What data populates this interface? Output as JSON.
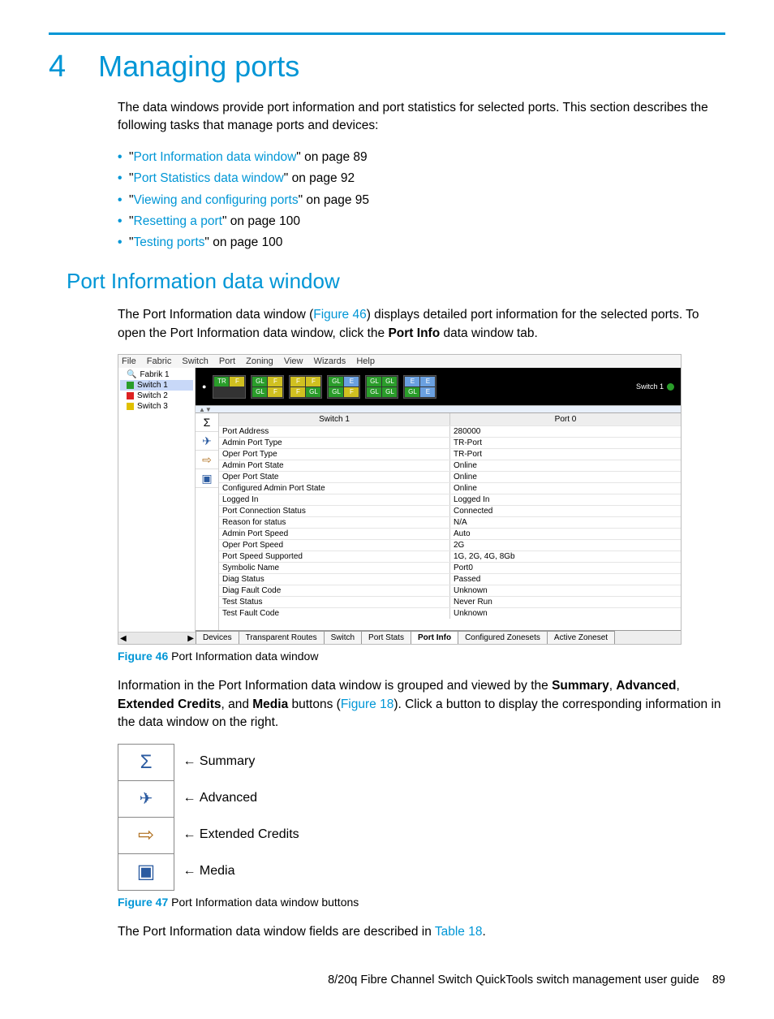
{
  "chapter": {
    "number": "4",
    "title": "Managing ports"
  },
  "intro": "The data windows provide port information and port statistics for selected ports. This section describes the following tasks that manage ports and devices:",
  "toc": [
    {
      "link": "Port Information data window",
      "suffix": " on page 89"
    },
    {
      "link": "Port Statistics data window",
      "suffix": " on page 92"
    },
    {
      "link": "Viewing and configuring ports",
      "suffix": " on page 95"
    },
    {
      "link": "Resetting a port",
      "suffix": " on page 100"
    },
    {
      "link": "Testing ports",
      "suffix": " on page 100"
    }
  ],
  "h2": "Port Information data window",
  "p2a": "The Port Information data window (",
  "p2link": "Figure 46",
  "p2b_1": ") displays detailed port information for the selected ports. To open the Port Information data window, click the ",
  "p2b_bold": "Port Info",
  "p2b_2": " data window tab.",
  "menus": [
    "File",
    "Fabric",
    "Switch",
    "Port",
    "Zoning",
    "View",
    "Wizards",
    "Help"
  ],
  "tree": {
    "root": "Fabrik 1",
    "items": [
      "Switch 1",
      "Switch 2",
      "Switch 3"
    ]
  },
  "faceplate": {
    "groups": [
      [
        [
          "TR",
          "g"
        ],
        [
          "F",
          "y"
        ]
      ],
      [
        [
          "GL",
          "g"
        ],
        [
          "F",
          "y"
        ],
        [
          "GL",
          "g"
        ],
        [
          "F",
          "y"
        ]
      ],
      [
        [
          "F",
          "y"
        ],
        [
          "F",
          "y"
        ],
        [
          "F",
          "y"
        ],
        [
          "GL",
          "g"
        ]
      ],
      [
        [
          "GL",
          "g"
        ],
        [
          "E",
          "b"
        ],
        [
          "GL",
          "g"
        ],
        [
          "F",
          "y"
        ]
      ],
      [
        [
          "GL",
          "g"
        ],
        [
          "GL",
          "g"
        ],
        [
          "GL",
          "g"
        ],
        [
          "GL",
          "g"
        ]
      ],
      [
        [
          "E",
          "b"
        ],
        [
          "E",
          "b"
        ],
        [
          "GL",
          "g"
        ],
        [
          "E",
          "b"
        ]
      ]
    ],
    "switch_label": "Switch 1"
  },
  "table": {
    "hdr_left": "Switch 1",
    "hdr_right": "Port 0",
    "rows": [
      [
        "Port Address",
        "280000"
      ],
      [
        "Admin Port Type",
        "TR-Port"
      ],
      [
        "Oper Port Type",
        "TR-Port"
      ],
      [
        "Admin Port State",
        "Online"
      ],
      [
        "Oper Port State",
        "Online"
      ],
      [
        "Configured Admin Port State",
        "Online"
      ],
      [
        "Logged In",
        "Logged In"
      ],
      [
        "Port Connection Status",
        "Connected"
      ],
      [
        "Reason for status",
        "N/A"
      ],
      [
        "Admin Port Speed",
        "Auto"
      ],
      [
        "Oper Port Speed",
        "2G"
      ],
      [
        "Port Speed Supported",
        "1G, 2G, 4G, 8Gb"
      ],
      [
        "Symbolic Name",
        "Port0"
      ],
      [
        "Diag Status",
        "Passed"
      ],
      [
        "Diag Fault Code",
        "Unknown"
      ],
      [
        "Test Status",
        "Never Run"
      ],
      [
        "Test Fault Code",
        "Unknown"
      ]
    ]
  },
  "tabs": [
    "Devices",
    "Transparent Routes",
    "Switch",
    "Port Stats",
    "Port Info",
    "Configured Zonesets",
    "Active Zoneset"
  ],
  "fig46": {
    "label": "Figure 46",
    "text": " Port Information data window"
  },
  "p3_1": "Information in the Port Information data window is grouped and viewed by the ",
  "p3_b1": "Summary",
  "p3_c1": ", ",
  "p3_b2": "Advanced",
  "p3_c2": ", ",
  "p3_b3": "Extended Credits",
  "p3_c3": ", and ",
  "p3_b4": "Media",
  "p3_2a": " buttons (",
  "p3_link": "Figure 18",
  "p3_2b": "). Click a button to display the corresponding information in the data window on the right.",
  "btns2": {
    "icons": [
      "Σ",
      "✈",
      "⇨",
      "▣"
    ],
    "labels": [
      "Summary",
      "Advanced",
      "Extended Credits",
      "Media"
    ]
  },
  "fig47": {
    "label": "Figure 47",
    "text": " Port Information data window buttons"
  },
  "p4a": "The Port Information data window fields are described in ",
  "p4link": "Table 18",
  "p4b": ".",
  "footer": {
    "title": "8/20q Fibre Channel Switch QuickTools switch management user guide",
    "page": "89"
  }
}
